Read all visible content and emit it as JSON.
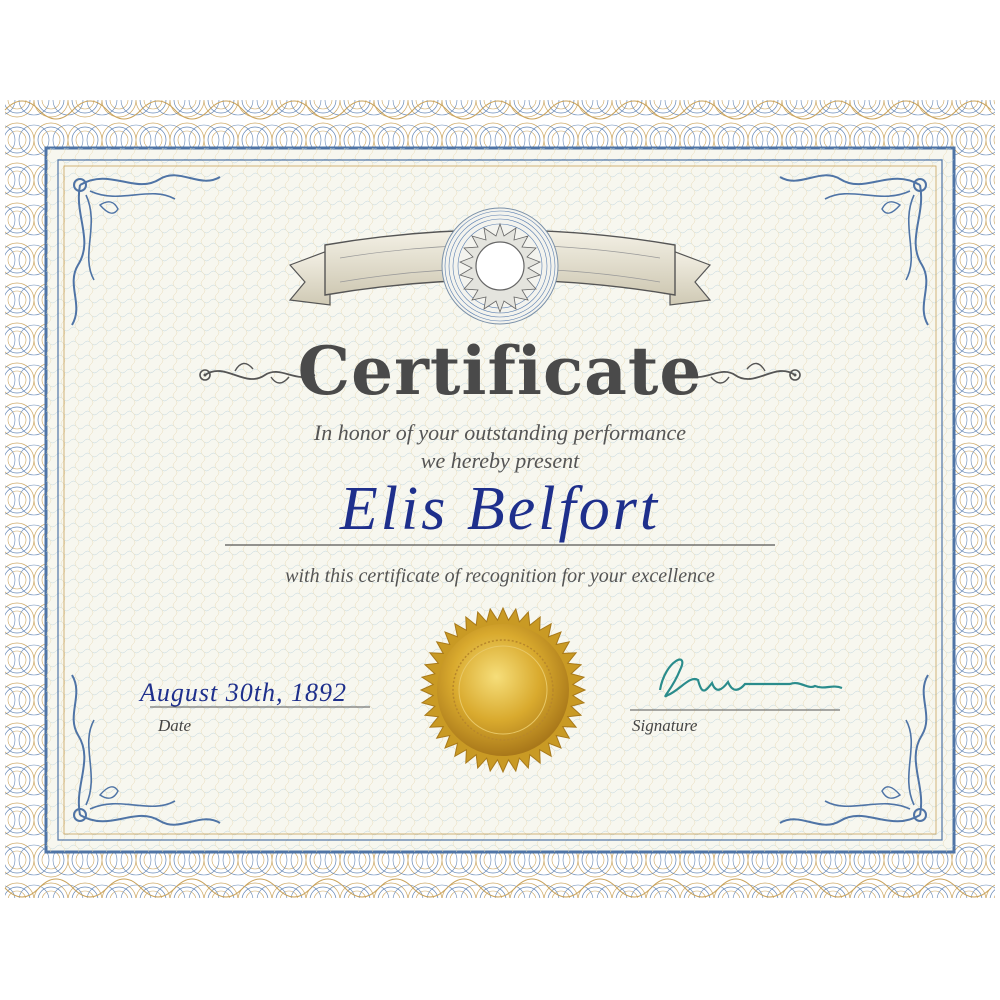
{
  "certificate": {
    "title": "Certificate",
    "line1": "In honor of your outstanding performance",
    "line2": "we hereby present",
    "recipient": "Elis Belfort",
    "line3": "with this certificate of recognition for your excellence",
    "date_value": "August 30th, 1892",
    "date_label": "Date",
    "signature_label": "Signature"
  },
  "colors": {
    "border_blue": "#4f74a6",
    "guilloche_gold": "#c9a25a",
    "paper": "#f7f7ef",
    "ink_blue": "#1e2f8c",
    "seal_gold": "#d4a832",
    "signature_teal": "#2a8c8c"
  },
  "icons": [
    "ribbon-banner-icon",
    "rosette-medallion-icon",
    "gold-seal-icon",
    "corner-flourish-icon",
    "signature-scribble-icon"
  ]
}
